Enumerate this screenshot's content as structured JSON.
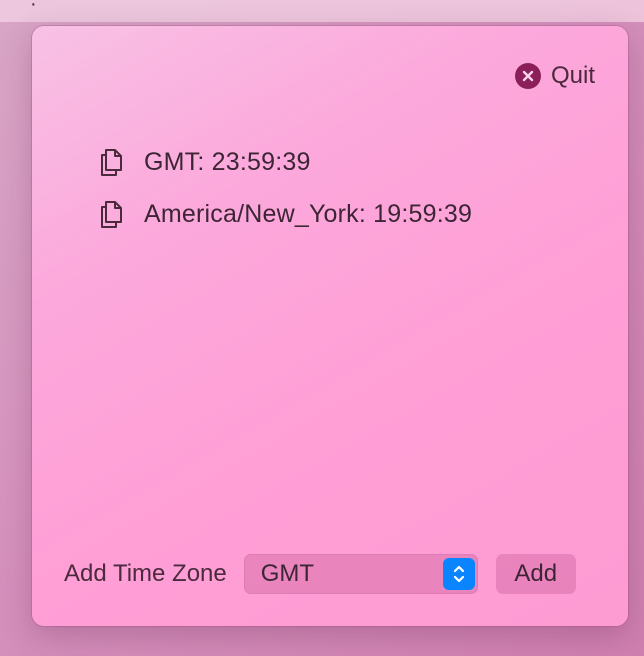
{
  "popover": {
    "quit_label": "Quit",
    "time_zones": [
      {
        "text": "GMT: 23:59:39",
        "icon": "copy-icon"
      },
      {
        "text": "America/New_York: 19:59:39",
        "icon": "copy-icon"
      }
    ],
    "footer": {
      "label": "Add Time Zone",
      "selected_zone": "GMT",
      "add_label": "Add"
    }
  },
  "colors": {
    "accent": "#0a84ff",
    "quit_icon": "#8a1f5a",
    "text": "#3d2535"
  }
}
